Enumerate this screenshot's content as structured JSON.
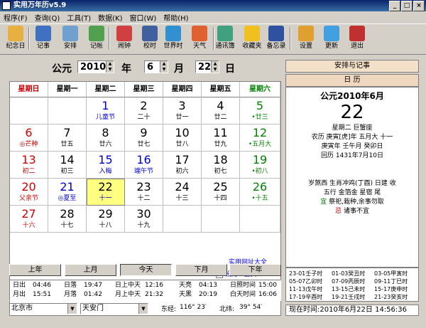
{
  "window": {
    "title": "实用万年历v5.9",
    "min": "_",
    "max": "□",
    "close": "×"
  },
  "menu": [
    "程序(F)",
    "查询(Q)",
    "工具(T)",
    "数据(K)",
    "窗口(W)",
    "帮助(H)"
  ],
  "toolbar": [
    {
      "label": "纪念日",
      "icon": "calendar-icon",
      "color": "#e8b040"
    },
    {
      "label": "记事",
      "icon": "notepad-icon",
      "color": "#4070c0"
    },
    {
      "label": "安排",
      "icon": "schedule-icon",
      "color": "#70a0d0"
    },
    {
      "label": "记帐",
      "icon": "ledger-icon",
      "color": "#50a050"
    },
    {
      "label": "闹钟",
      "icon": "alarm-clock-icon",
      "color": "#d04040"
    },
    {
      "label": "校时",
      "icon": "sync-time-icon",
      "color": "#4060a0"
    },
    {
      "label": "世界时",
      "icon": "globe-icon",
      "color": "#3090d0"
    },
    {
      "label": "天气",
      "icon": "weather-icon",
      "color": "#e06030"
    },
    {
      "label": "通讯簿",
      "icon": "address-book-icon",
      "color": "#40a080"
    },
    {
      "label": "收藏夹",
      "icon": "star-icon",
      "color": "#f0c020"
    },
    {
      "label": "备忘录",
      "icon": "memo-icon",
      "color": "#3050a0"
    },
    {
      "label": "设置",
      "icon": "settings-icon",
      "color": "#e0a030"
    },
    {
      "label": "更新",
      "icon": "update-icon",
      "color": "#40a0e0"
    },
    {
      "label": "退出",
      "icon": "exit-icon",
      "color": "#c03030"
    }
  ],
  "datebar": {
    "era": "公元",
    "year": "2010",
    "year_label": "年",
    "month": "6",
    "month_label": "月",
    "day": "22",
    "day_label": "日"
  },
  "weekdays": [
    "星期日",
    "星期一",
    "星期二",
    "星期三",
    "星期四",
    "星期五",
    "星期六"
  ],
  "calendar": [
    [
      null,
      null,
      {
        "d": "1",
        "l": "儿童节"
      },
      {
        "d": "2",
        "l": "二十"
      },
      {
        "d": "3",
        "l": "廿一"
      },
      {
        "d": "4",
        "l": "廿二"
      },
      {
        "d": "5",
        "l": "•廿三"
      }
    ],
    [
      {
        "d": "6",
        "l": "◎芒种"
      },
      {
        "d": "7",
        "l": "廿五"
      },
      {
        "d": "8",
        "l": "廿六"
      },
      {
        "d": "9",
        "l": "廿七"
      },
      {
        "d": "10",
        "l": "廿八"
      },
      {
        "d": "11",
        "l": "廿九"
      },
      {
        "d": "12",
        "l": "•五月大"
      }
    ],
    [
      {
        "d": "13",
        "l": "初二"
      },
      {
        "d": "14",
        "l": "初三"
      },
      {
        "d": "15",
        "l": "入梅"
      },
      {
        "d": "16",
        "l": "端午节"
      },
      {
        "d": "17",
        "l": "初六"
      },
      {
        "d": "18",
        "l": "初七"
      },
      {
        "d": "19",
        "l": "•初八"
      }
    ],
    [
      {
        "d": "20",
        "l": "父亲节"
      },
      {
        "d": "21",
        "l": "◎夏至"
      },
      {
        "d": "22",
        "l": "十一"
      },
      {
        "d": "23",
        "l": "十二"
      },
      {
        "d": "24",
        "l": "十三"
      },
      {
        "d": "25",
        "l": "十四"
      },
      {
        "d": "26",
        "l": "•十五"
      }
    ],
    [
      {
        "d": "27",
        "l": "十六"
      },
      {
        "d": "28",
        "l": "十七"
      },
      {
        "d": "29",
        "l": "十八"
      },
      {
        "d": "30",
        "l": "十九"
      },
      null,
      null,
      null
    ],
    [
      null,
      null,
      null,
      null,
      null,
      null,
      null
    ]
  ],
  "links": {
    "site": "实用网址大全",
    "homepage": "设为IE首页"
  },
  "nav": [
    "上年",
    "上月",
    "今天",
    "下月",
    "下年"
  ],
  "info": [
    [
      "日出",
      "04:46",
      "日落",
      "19:47",
      "日上中天",
      "12:16",
      "天亮",
      "04:13",
      "日照时间",
      "15:00"
    ],
    [
      "月出",
      "15:51",
      "月落",
      "01:42",
      "月上中天",
      "21:32",
      "天黑",
      "20:19",
      "白天时间",
      "16:06"
    ]
  ],
  "location": {
    "city": "北京市",
    "spot": "天安门",
    "longitude_label": "东经:",
    "longitude": "116° 23′",
    "latitude_label": "北纬:",
    "latitude": "39° 54′"
  },
  "right": {
    "tab": "安排与记事",
    "subtab": "日  历",
    "title": "公元2010年6月",
    "bigday": "22",
    "weekday_sign": "星期二  巨蟹座",
    "lunar": "农历 庚寅[虎]年 五月大 十一",
    "ganzhi": "庚寅年 壬午月 癸卯日",
    "islamic": "回历 1431年7月10日",
    "line1": "岁煞西 生肖冲鸡(丁酉)  日建 收",
    "line2": "五行 金箔金  星宿 尾",
    "yi_label": "宜",
    "yi": "祭祀,栽种,余事勿取",
    "ji_label": "忌",
    "ji": "诸事不宜",
    "hours": [
      [
        "23-01壬子时",
        "01-03癸丑时",
        "03-05甲寅时"
      ],
      [
        "05-07乙卯时",
        "07-09丙辰时",
        "09-11丁巳时"
      ],
      [
        "11-13戊午时",
        "13-15己未时",
        "15-17庚申时"
      ],
      [
        "17-19辛酉时",
        "19-21壬戌时",
        "21-23癸亥时"
      ]
    ],
    "now_label": "现在时间:",
    "now": "2010年6月22日  14:56:36"
  },
  "colors": {
    "sunday": "#cc0000",
    "saturday": "#008000",
    "festival": "#0000cc",
    "today": "#ffff80"
  }
}
